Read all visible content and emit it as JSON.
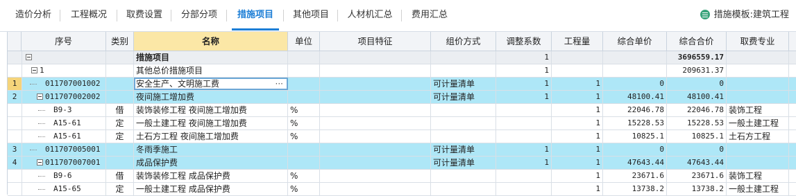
{
  "tabs": [
    {
      "label": "造价分析"
    },
    {
      "label": "工程概况"
    },
    {
      "label": "取费设置"
    },
    {
      "label": "分部分项"
    },
    {
      "label": "措施项目"
    },
    {
      "label": "其他项目"
    },
    {
      "label": "人材机汇总"
    },
    {
      "label": "费用汇总"
    }
  ],
  "template": {
    "label": "措施模板:建筑工程"
  },
  "columns": {
    "seq": "序号",
    "category": "类别",
    "name": "名称",
    "unit": "单位",
    "feature": "项目特征",
    "price_mode": "组价方式",
    "factor": "调整系数",
    "qty": "工程量",
    "unit_price": "综合单价",
    "total": "综合合价",
    "fee_major": "取费专业"
  },
  "rows": [
    {
      "rownum": "",
      "seq": "",
      "cat": "",
      "name": "措施项目",
      "unit": "",
      "feature": "",
      "mode": "",
      "factor": "1",
      "qty": "",
      "price": "",
      "total": "3696559.17",
      "major": ""
    },
    {
      "rownum": "",
      "seq": "1",
      "cat": "",
      "name": "其他总价措施项目",
      "unit": "",
      "feature": "",
      "mode": "",
      "factor": "1",
      "qty": "",
      "price": "",
      "total": "209631.37",
      "major": ""
    },
    {
      "rownum": "1",
      "seq": "011707001002",
      "cat": "",
      "name": "安全生产、文明施工费",
      "unit": "",
      "feature": "",
      "mode": "可计量清单",
      "factor": "1",
      "qty": "1",
      "price": "0",
      "total": "0",
      "major": "",
      "ellipsis": "···"
    },
    {
      "rownum": "2",
      "seq": "011707002002",
      "cat": "",
      "name": "夜间施工增加费",
      "unit": "",
      "feature": "",
      "mode": "可计量清单",
      "factor": "1",
      "qty": "1",
      "price": "48100.41",
      "total": "48100.41",
      "major": ""
    },
    {
      "rownum": "",
      "seq": "B9-3",
      "cat": "借",
      "name": "装饰装修工程 夜间施工增加费",
      "unit": "%",
      "feature": "",
      "mode": "",
      "factor": "",
      "qty": "1",
      "price": "22046.78",
      "total": "22046.78",
      "major": "装饰工程"
    },
    {
      "rownum": "",
      "seq": "A15-61",
      "cat": "定",
      "name": "一般土建工程 夜间施工增加费",
      "unit": "%",
      "feature": "",
      "mode": "",
      "factor": "",
      "qty": "1",
      "price": "15228.53",
      "total": "15228.53",
      "major": "一般土建工程"
    },
    {
      "rownum": "",
      "seq": "A15-61",
      "cat": "定",
      "name": "土石方工程 夜间施工增加费",
      "unit": "%",
      "feature": "",
      "mode": "",
      "factor": "",
      "qty": "1",
      "price": "10825.1",
      "total": "10825.1",
      "major": "土石方工程"
    },
    {
      "rownum": "3",
      "seq": "011707005001",
      "cat": "",
      "name": "冬雨季施工",
      "unit": "",
      "feature": "",
      "mode": "可计量清单",
      "factor": "1",
      "qty": "1",
      "price": "0",
      "total": "0",
      "major": ""
    },
    {
      "rownum": "4",
      "seq": "011707007001",
      "cat": "",
      "name": "成品保护费",
      "unit": "",
      "feature": "",
      "mode": "可计量清单",
      "factor": "1",
      "qty": "1",
      "price": "47643.44",
      "total": "47643.44",
      "major": ""
    },
    {
      "rownum": "",
      "seq": "B9-6",
      "cat": "借",
      "name": "装饰装修工程 成品保护费",
      "unit": "%",
      "feature": "",
      "mode": "",
      "factor": "",
      "qty": "1",
      "price": "23671.6",
      "total": "23671.6",
      "major": "装饰工程"
    },
    {
      "rownum": "",
      "seq": "A15-65",
      "cat": "定",
      "name": "一般土建工程 成品保护费",
      "unit": "%",
      "feature": "",
      "mode": "",
      "factor": "",
      "qty": "1",
      "price": "13738.2",
      "total": "13738.2",
      "major": "一般土建工程"
    }
  ],
  "colors": {
    "accent": "#1c7ed6",
    "highlight_row": "#aee7f7",
    "header_name": "#fbe7a6"
  }
}
